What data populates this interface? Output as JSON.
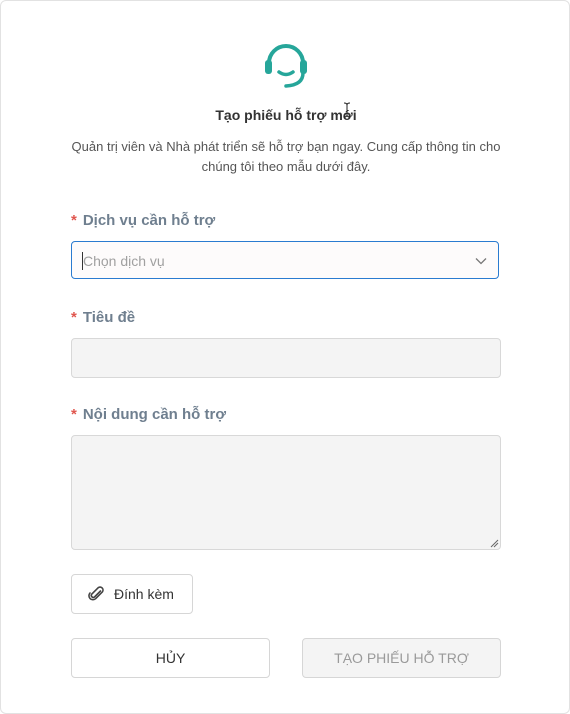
{
  "dialog": {
    "title": "Tạo phiếu hỗ trợ mới",
    "subtitle": "Quản trị viên và Nhà phát triển sẽ hỗ trợ bạn ngay. Cung cấp thông tin cho chúng tôi theo mẫu dưới đây.",
    "header_icon": "headset-icon",
    "accent_color": "#26a69a"
  },
  "form": {
    "required_marker": "*",
    "service": {
      "label": "Dịch vụ cần hỗ trợ",
      "placeholder": "Chọn dịch vụ",
      "value": ""
    },
    "title_field": {
      "label": "Tiêu đề",
      "value": ""
    },
    "content": {
      "label": "Nội dung cần hỗ trợ",
      "value": ""
    },
    "attach": {
      "label": "Đính kèm",
      "icon": "paperclip-icon"
    }
  },
  "actions": {
    "cancel_label": "HỦY",
    "submit_label": "TẠO PHIẾU HỖ TRỢ"
  }
}
